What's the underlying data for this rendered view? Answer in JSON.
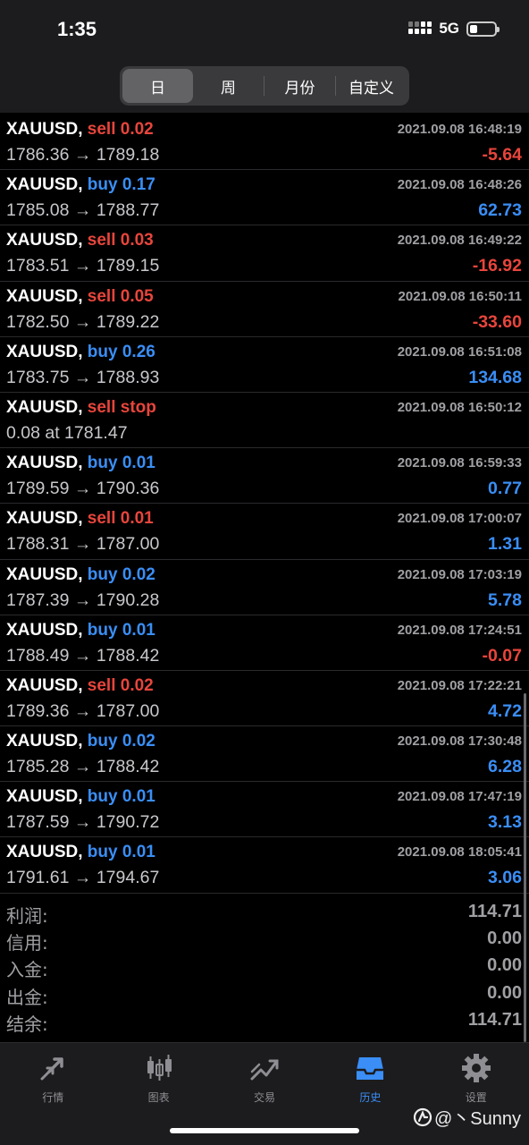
{
  "status": {
    "time": "1:35",
    "network": "5G",
    "battery_level": 0.3
  },
  "segments": [
    {
      "label": "日",
      "active": true
    },
    {
      "label": "周",
      "active": false
    },
    {
      "label": "月份",
      "active": false
    },
    {
      "label": "自定义",
      "active": false
    }
  ],
  "trades": [
    {
      "symbol": "XAUUSD,",
      "side": "sell 0.02",
      "side_type": "sell",
      "time": "2021.09.08 16:48:19",
      "prices": "1786.36 → 1789.18",
      "profit": "-5.64",
      "profit_sign": "neg"
    },
    {
      "symbol": "XAUUSD,",
      "side": "buy 0.17",
      "side_type": "buy",
      "time": "2021.09.08 16:48:26",
      "prices": "1785.08 → 1788.77",
      "profit": "62.73",
      "profit_sign": "pos"
    },
    {
      "symbol": "XAUUSD,",
      "side": "sell 0.03",
      "side_type": "sell",
      "time": "2021.09.08 16:49:22",
      "prices": "1783.51 → 1789.15",
      "profit": "-16.92",
      "profit_sign": "neg"
    },
    {
      "symbol": "XAUUSD,",
      "side": "sell 0.05",
      "side_type": "sell",
      "time": "2021.09.08 16:50:11",
      "prices": "1782.50 → 1789.22",
      "profit": "-33.60",
      "profit_sign": "neg"
    },
    {
      "symbol": "XAUUSD,",
      "side": "buy 0.26",
      "side_type": "buy",
      "time": "2021.09.08 16:51:08",
      "prices": "1783.75 → 1788.93",
      "profit": "134.68",
      "profit_sign": "pos"
    },
    {
      "symbol": "XAUUSD,",
      "side": "sell stop",
      "side_type": "sell",
      "time": "2021.09.08 16:50:12",
      "prices": "0.08 at 1781.47",
      "profit": "",
      "profit_sign": "pos"
    },
    {
      "symbol": "XAUUSD,",
      "side": "buy 0.01",
      "side_type": "buy",
      "time": "2021.09.08 16:59:33",
      "prices": "1789.59 → 1790.36",
      "profit": "0.77",
      "profit_sign": "pos"
    },
    {
      "symbol": "XAUUSD,",
      "side": "sell 0.01",
      "side_type": "sell",
      "time": "2021.09.08 17:00:07",
      "prices": "1788.31 → 1787.00",
      "profit": "1.31",
      "profit_sign": "pos"
    },
    {
      "symbol": "XAUUSD,",
      "side": "buy 0.02",
      "side_type": "buy",
      "time": "2021.09.08 17:03:19",
      "prices": "1787.39 → 1790.28",
      "profit": "5.78",
      "profit_sign": "pos"
    },
    {
      "symbol": "XAUUSD,",
      "side": "buy 0.01",
      "side_type": "buy",
      "time": "2021.09.08 17:24:51",
      "prices": "1788.49 → 1788.42",
      "profit": "-0.07",
      "profit_sign": "neg"
    },
    {
      "symbol": "XAUUSD,",
      "side": "sell 0.02",
      "side_type": "sell",
      "time": "2021.09.08 17:22:21",
      "prices": "1789.36 → 1787.00",
      "profit": "4.72",
      "profit_sign": "pos"
    },
    {
      "symbol": "XAUUSD,",
      "side": "buy 0.02",
      "side_type": "buy",
      "time": "2021.09.08 17:30:48",
      "prices": "1785.28 → 1788.42",
      "profit": "6.28",
      "profit_sign": "pos"
    },
    {
      "symbol": "XAUUSD,",
      "side": "buy 0.01",
      "side_type": "buy",
      "time": "2021.09.08 17:47:19",
      "prices": "1787.59 → 1790.72",
      "profit": "3.13",
      "profit_sign": "pos"
    },
    {
      "symbol": "XAUUSD,",
      "side": "buy 0.01",
      "side_type": "buy",
      "time": "2021.09.08 18:05:41",
      "prices": "1791.61 → 1794.67",
      "profit": "3.06",
      "profit_sign": "pos"
    }
  ],
  "summary": [
    {
      "label": "利润:",
      "value": "114.71"
    },
    {
      "label": "信用:",
      "value": "0.00"
    },
    {
      "label": "入金:",
      "value": "0.00"
    },
    {
      "label": "出金:",
      "value": "0.00"
    },
    {
      "label": "结余:",
      "value": "114.71"
    }
  ],
  "tabs": [
    {
      "label": "行情",
      "icon": "quotes-arrows-icon",
      "active": false
    },
    {
      "label": "图表",
      "icon": "candlestick-chart-icon",
      "active": false
    },
    {
      "label": "交易",
      "icon": "trade-trend-icon",
      "active": false
    },
    {
      "label": "历史",
      "icon": "history-inbox-icon",
      "active": true
    },
    {
      "label": "设置",
      "icon": "gear-icon",
      "active": false
    }
  ],
  "watermark": {
    "text": "@丶Sunny"
  },
  "colors": {
    "sell": "#e8453c",
    "buy": "#3a8ef6",
    "active_tab": "#3a8ef6",
    "muted": "#a0a0a4"
  }
}
